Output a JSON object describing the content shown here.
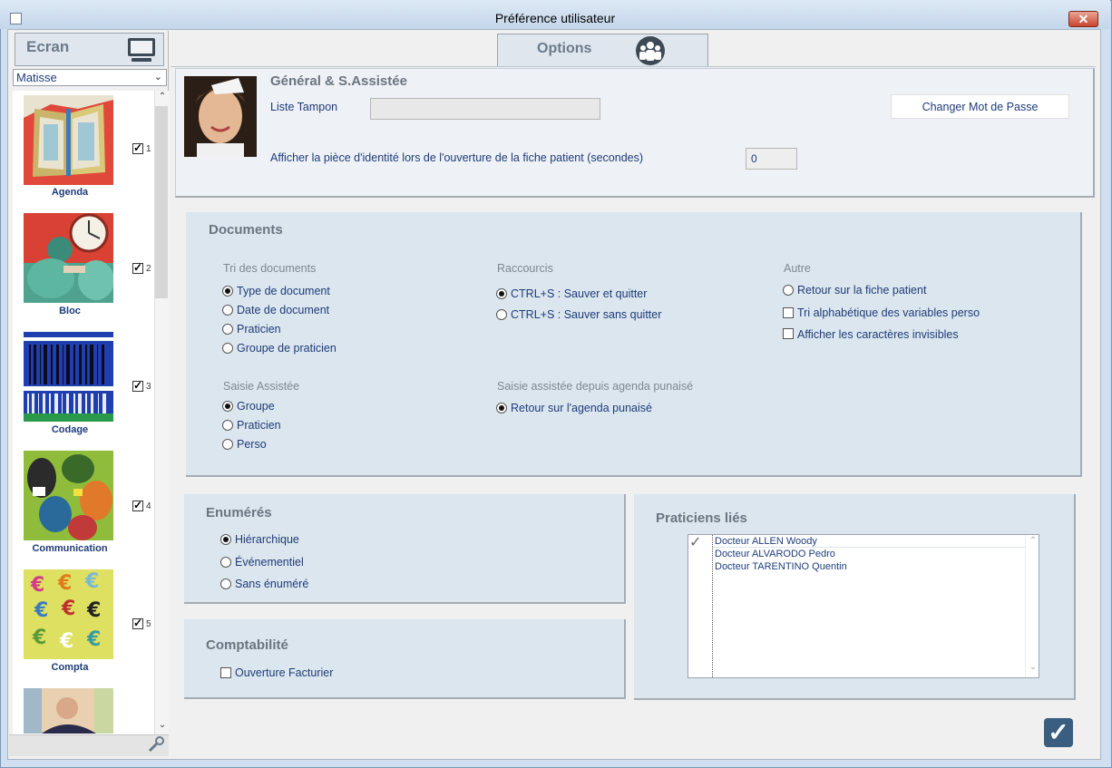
{
  "window": {
    "title": "Préférence utilisateur",
    "close_label": "✕"
  },
  "left_panel": {
    "header_label": "Ecran",
    "selector_value": "Matisse",
    "items": [
      {
        "label": "Agenda",
        "checked": true,
        "num": "1"
      },
      {
        "label": "Bloc",
        "checked": true,
        "num": "2"
      },
      {
        "label": "Codage",
        "checked": true,
        "num": "3"
      },
      {
        "label": "Communication",
        "checked": true,
        "num": "4"
      },
      {
        "label": "Compta",
        "checked": true,
        "num": "5"
      }
    ]
  },
  "options_tab": {
    "label": "Options"
  },
  "general": {
    "title": "Général & S.Assistée",
    "liste_tampon_label": "Liste Tampon",
    "liste_tampon_value": "",
    "change_password_label": "Changer Mot de Passe",
    "id_piece_label": "Afficher la pièce d'identité lors de l'ouverture de la fiche patient (secondes)",
    "id_piece_value": "0"
  },
  "documents": {
    "title": "Documents",
    "tri": {
      "title": "Tri des documents",
      "options": [
        "Type de document",
        "Date de document",
        "Praticien",
        "Groupe de praticien"
      ],
      "selected": 0
    },
    "raccourcis": {
      "title": "Raccourcis",
      "options": [
        "CTRL+S : Sauver et quitter",
        "CTRL+S : Sauver sans quitter"
      ],
      "selected": 0
    },
    "autre": {
      "title": "Autre",
      "radio_label": "Retour sur la fiche patient",
      "checkbox_1": "Tri alphabétique des variables perso",
      "checkbox_2": "Afficher les caractères invisibles"
    },
    "saisie": {
      "title": "Saisie Assistée",
      "options": [
        "Groupe",
        "Praticien",
        "Perso"
      ],
      "selected": 0
    },
    "saisie_agenda": {
      "title": "Saisie assistée depuis agenda punaisé",
      "radio_label": "Retour sur l'agenda punaisé",
      "selected": true
    }
  },
  "enumeres": {
    "title": "Enumérés",
    "options": [
      "Hiérarchique",
      "Événementiel",
      "Sans énuméré"
    ],
    "selected": 0
  },
  "comptabilite": {
    "title": "Comptabilité",
    "checkbox_label": "Ouverture Facturier"
  },
  "praticiens": {
    "title": "Praticiens liés",
    "rows": [
      "Docteur ALLEN Woody",
      "Docteur ALVARODO Pedro",
      "Docteur TARENTINO Quentin"
    ]
  },
  "footer": {
    "validate_label": "✓"
  },
  "colors": {
    "accent": "#1e3c78",
    "panel": "#dce6ef",
    "validate": "#3a5e80"
  }
}
